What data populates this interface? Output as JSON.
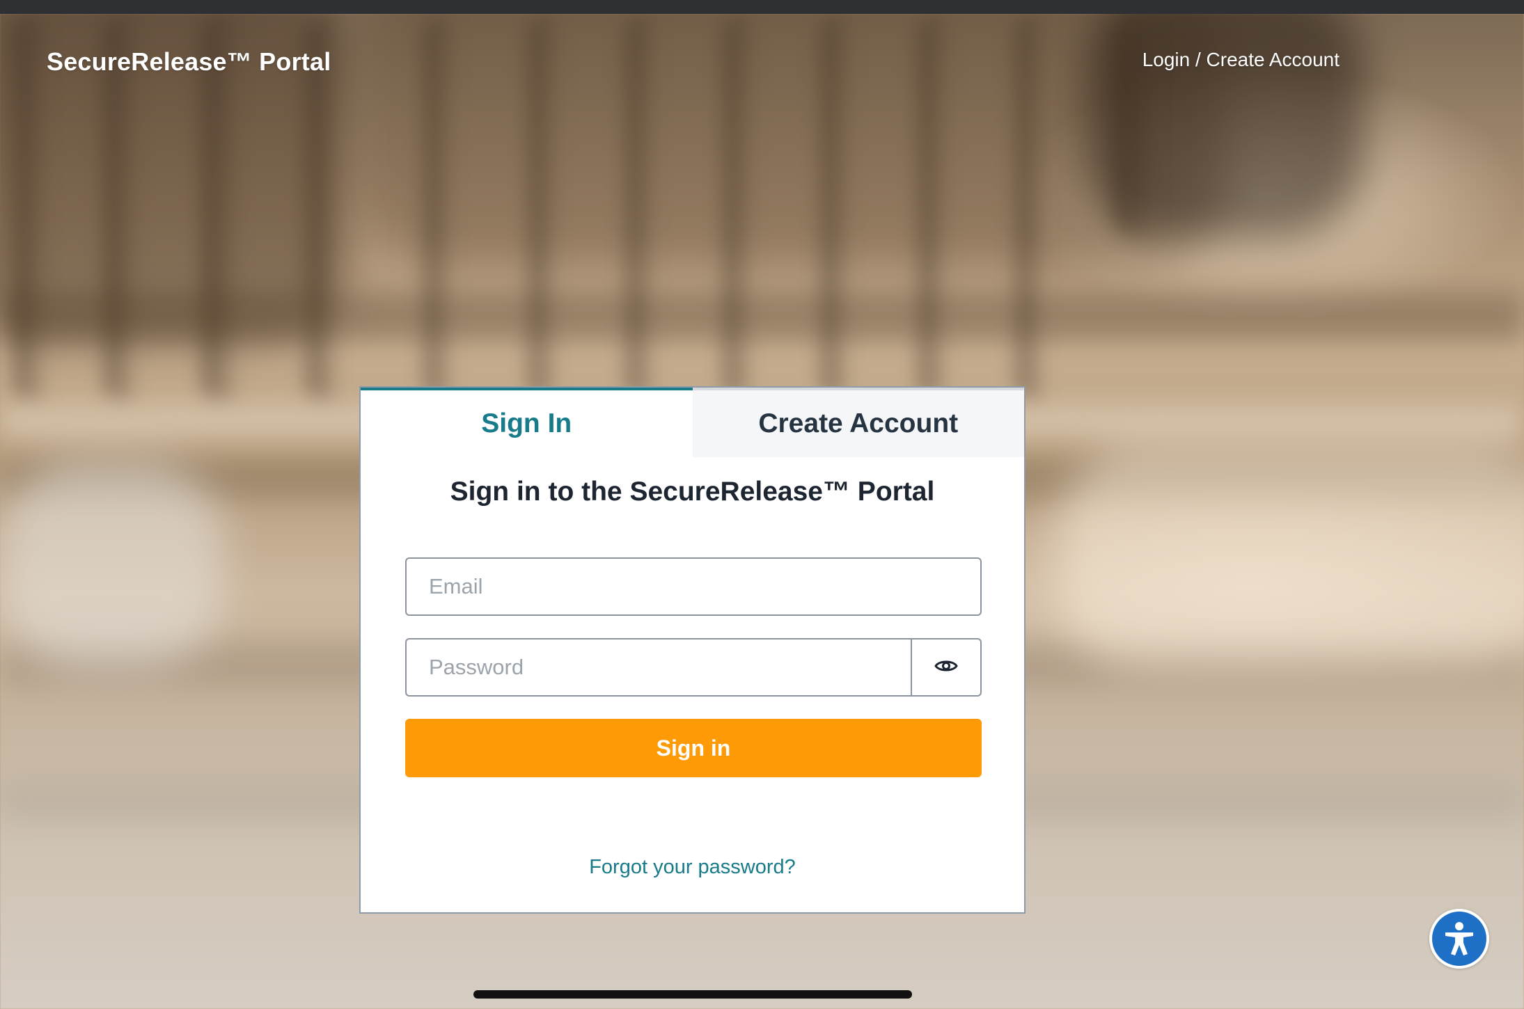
{
  "header": {
    "brand": "SecureRelease™ Portal",
    "nav_link": "Login / Create Account"
  },
  "card": {
    "tabs": [
      {
        "label": "Sign In",
        "active": true
      },
      {
        "label": "Create Account",
        "active": false
      }
    ],
    "heading": "Sign in to the SecureRelease™ Portal",
    "email": {
      "value": "",
      "placeholder": "Email"
    },
    "password": {
      "value": "",
      "placeholder": "Password"
    },
    "toggle_password_icon": "eye-icon",
    "submit_label": "Sign in",
    "forgot_link": "Forgot your password?"
  },
  "accessibility": {
    "icon": "accessibility-icon"
  },
  "colors": {
    "accent": "#177b8a",
    "button": "#fd9a06",
    "heading": "#1d2530",
    "accessibility": "#1d70c5"
  }
}
